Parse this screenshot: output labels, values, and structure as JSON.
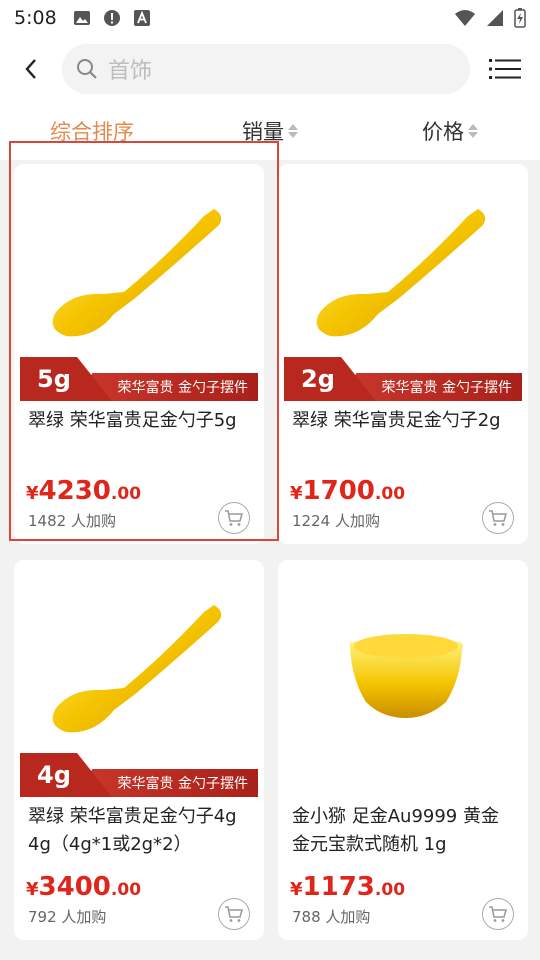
{
  "status_bar": {
    "time": "5:08"
  },
  "search": {
    "placeholder": "首饰"
  },
  "sort": {
    "tabs": [
      {
        "label": "综合排序"
      },
      {
        "label": "销量"
      },
      {
        "label": "价格"
      }
    ]
  },
  "products": [
    {
      "ribbon_weight": "5g",
      "ribbon_text": "荣华富贵 金勺子摆件",
      "title": "翠绿 荣华富贵足金勺子5g",
      "price_symbol": "¥",
      "price_int": "4230",
      "price_dec": ".00",
      "sales": "1482 人加购"
    },
    {
      "ribbon_weight": "2g",
      "ribbon_text": "荣华富贵 金勺子摆件",
      "title": "翠绿 荣华富贵足金勺子2g",
      "price_symbol": "¥",
      "price_int": "1700",
      "price_dec": ".00",
      "sales": "1224 人加购"
    },
    {
      "ribbon_weight": "4g",
      "ribbon_text": "荣华富贵 金勺子摆件",
      "title": "翠绿 荣华富贵足金勺子4g 4g（4g*1或2g*2）",
      "price_symbol": "¥",
      "price_int": "3400",
      "price_dec": ".00",
      "sales": "792 人加购"
    },
    {
      "title": "金小猕 足金Au9999 黄金 金元宝款式随机 1g",
      "price_symbol": "¥",
      "price_int": "1173",
      "price_dec": ".00",
      "sales": "788 人加购"
    }
  ],
  "colors": {
    "accent": "#e58a4e",
    "price": "#e0261b",
    "ribbon": "#b9281f",
    "gold": "#f5c400"
  }
}
